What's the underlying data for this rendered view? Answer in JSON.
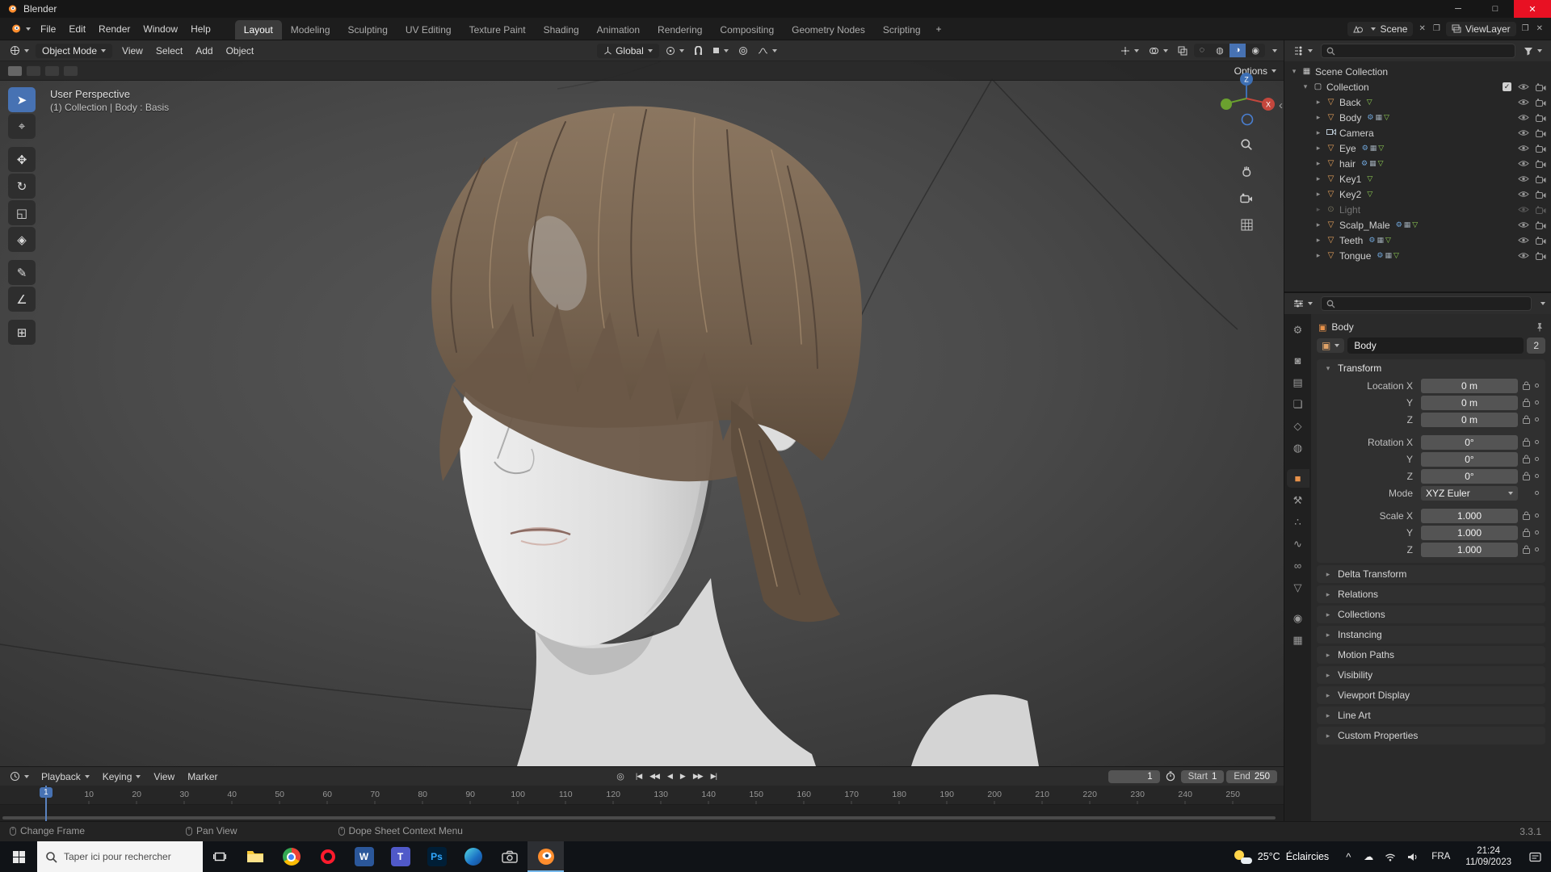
{
  "titlebar": {
    "title": "Blender",
    "minimize": "─",
    "maximize": "□",
    "close": "✕"
  },
  "icon_glyphs": {
    "close": "✕",
    "duplicate": "❐",
    "collapse": "‹",
    "caret": "^",
    "cloud": "☁",
    "scissors": "✄"
  },
  "topbar": {
    "menus": [
      "File",
      "Edit",
      "Render",
      "Window",
      "Help"
    ],
    "workspaces": [
      "Layout",
      "Modeling",
      "Sculpting",
      "UV Editing",
      "Texture Paint",
      "Shading",
      "Animation",
      "Rendering",
      "Compositing",
      "Geometry Nodes",
      "Scripting"
    ],
    "active_workspace": "Layout",
    "add_tab": "+",
    "scene_label": "Scene",
    "viewlayer_label": "ViewLayer"
  },
  "toolheader": {
    "mode": "Object Mode",
    "menus": [
      "View",
      "Select",
      "Add",
      "Object"
    ],
    "orientation": "Global",
    "options_label": "Options",
    "shading_modes": [
      {
        "name": "wireframe",
        "glyph": "◌"
      },
      {
        "name": "solid",
        "glyph": "◍"
      },
      {
        "name": "material-preview",
        "glyph": "◑",
        "selected": true
      },
      {
        "name": "rendered",
        "glyph": "◉"
      }
    ]
  },
  "viewport": {
    "perspective_label": "User Perspective",
    "context_label": "(1) Collection | Body : Basis",
    "gizmo": {
      "x": "X",
      "z": "Z"
    },
    "tools": [
      {
        "name": "select-box",
        "glyph": "➤",
        "active": true
      },
      {
        "name": "cursor",
        "glyph": "⌖"
      },
      {
        "name": "move",
        "glyph": "✥",
        "gap": true
      },
      {
        "name": "rotate",
        "glyph": "↻"
      },
      {
        "name": "scale",
        "glyph": "◱"
      },
      {
        "name": "transform",
        "glyph": "◈"
      },
      {
        "name": "annotate",
        "glyph": "✎",
        "gap": true
      },
      {
        "name": "measure",
        "glyph": "∠"
      },
      {
        "name": "add-cube",
        "glyph": "⊞",
        "gap": true
      }
    ]
  },
  "outliner": {
    "root_label": "Scene Collection",
    "collection_label": "Collection",
    "items": [
      {
        "name": "Back",
        "icon": "mesh",
        "badges": [
          "tri"
        ]
      },
      {
        "name": "Body",
        "icon": "mesh",
        "badges": [
          "wrench",
          "grid",
          "tri"
        ]
      },
      {
        "name": "Camera",
        "icon": "camera",
        "badges": []
      },
      {
        "name": "Eye",
        "icon": "mesh",
        "badges": [
          "wrench",
          "grid",
          "tri"
        ]
      },
      {
        "name": "hair",
        "icon": "mesh",
        "badges": [
          "wrench",
          "grid",
          "tri"
        ]
      },
      {
        "name": "Key1",
        "icon": "mesh",
        "badges": [
          "tri"
        ]
      },
      {
        "name": "Key2",
        "icon": "mesh",
        "badges": [
          "tri"
        ]
      },
      {
        "name": "Light",
        "icon": "light",
        "badges": [],
        "dimmed": true
      },
      {
        "name": "Scalp_Male",
        "icon": "mesh",
        "badges": [
          "wrench",
          "grid",
          "tri"
        ]
      },
      {
        "name": "Teeth",
        "icon": "mesh",
        "badges": [
          "wrench",
          "grid",
          "tri"
        ]
      },
      {
        "name": "Tongue",
        "icon": "mesh",
        "badges": [
          "wrench",
          "grid",
          "tri"
        ]
      }
    ]
  },
  "properties": {
    "tabs": [
      {
        "name": "tool",
        "glyph": "⚙"
      },
      {
        "name": "render",
        "glyph": "◙",
        "gap": true
      },
      {
        "name": "output",
        "glyph": "▤"
      },
      {
        "name": "view-layer",
        "glyph": "❏"
      },
      {
        "name": "scene",
        "glyph": "◇"
      },
      {
        "name": "world",
        "glyph": "◍"
      },
      {
        "name": "object",
        "glyph": "■",
        "selected": true,
        "gap": true
      },
      {
        "name": "modifiers",
        "glyph": "⚒"
      },
      {
        "name": "particles",
        "glyph": "∴"
      },
      {
        "name": "physics",
        "glyph": "∿"
      },
      {
        "name": "constraints",
        "glyph": "∞"
      },
      {
        "name": "object-data",
        "glyph": "▽"
      },
      {
        "name": "material",
        "glyph": "◉",
        "gap": true
      },
      {
        "name": "texture",
        "glyph": "▦"
      }
    ],
    "breadcrumb": "Body",
    "name_value": "Body",
    "users_count": "2",
    "transform_title": "Transform",
    "transform_rows": [
      {
        "label": "Location X",
        "value": "0 m"
      },
      {
        "label": "Y",
        "value": "0 m"
      },
      {
        "label": "Z",
        "value": "0 m"
      },
      {
        "label": "Rotation X",
        "value": "0°",
        "gap": true
      },
      {
        "label": "Y",
        "value": "0°"
      },
      {
        "label": "Z",
        "value": "0°"
      },
      {
        "label": "Mode",
        "value": "XYZ Euler",
        "dropdown": true
      },
      {
        "label": "Scale X",
        "value": "1.000",
        "gap": true
      },
      {
        "label": "Y",
        "value": "1.000"
      },
      {
        "label": "Z",
        "value": "1.000"
      }
    ],
    "panels": [
      "Delta Transform",
      "Relations",
      "Collections",
      "Instancing",
      "Motion Paths",
      "Visibility",
      "Viewport Display",
      "Line Art",
      "Custom Properties"
    ]
  },
  "timeline": {
    "menus": [
      {
        "label": "Playback",
        "chev": true
      },
      {
        "label": "Keying",
        "chev": true
      },
      {
        "label": "View"
      },
      {
        "label": "Marker"
      }
    ],
    "autokey_glyph": "◎",
    "transport": [
      {
        "name": "jump-to-start",
        "glyph": "|◀"
      },
      {
        "name": "prev-keyframe",
        "glyph": "◀◀"
      },
      {
        "name": "play-reverse",
        "glyph": "◀"
      },
      {
        "name": "play",
        "glyph": "▶"
      },
      {
        "name": "next-keyframe",
        "glyph": "▶▶"
      },
      {
        "name": "jump-to-end",
        "glyph": "▶|"
      }
    ],
    "current_frame": "1",
    "playhead_frame": 1,
    "start_label": "Start",
    "start_value": "1",
    "end_label": "End",
    "end_value": "250",
    "ticks": [
      10,
      20,
      30,
      40,
      50,
      60,
      70,
      80,
      90,
      100,
      110,
      120,
      130,
      140,
      150,
      160,
      170,
      180,
      190,
      200,
      210,
      220,
      230,
      240,
      250
    ]
  },
  "statusbar": {
    "hints": [
      "Change Frame",
      "Pan View",
      "Dope Sheet Context Menu"
    ],
    "version": "3.3.1"
  },
  "taskbar": {
    "search_placeholder": "Taper ici pour rechercher",
    "apps": [
      "explorer",
      "chrome",
      "opera",
      "word",
      "teams",
      "photoshop",
      "edge",
      "capture",
      "blender"
    ],
    "active_app": "blender",
    "tray": {
      "temp": "25°C",
      "condition": "Éclaircies",
      "lang": "FRA",
      "time": "21:24",
      "date": "11/09/2023"
    }
  },
  "colors": {
    "accent": "#4772b3",
    "hair": "#7d6a55",
    "skin": "#e3e3e3"
  }
}
